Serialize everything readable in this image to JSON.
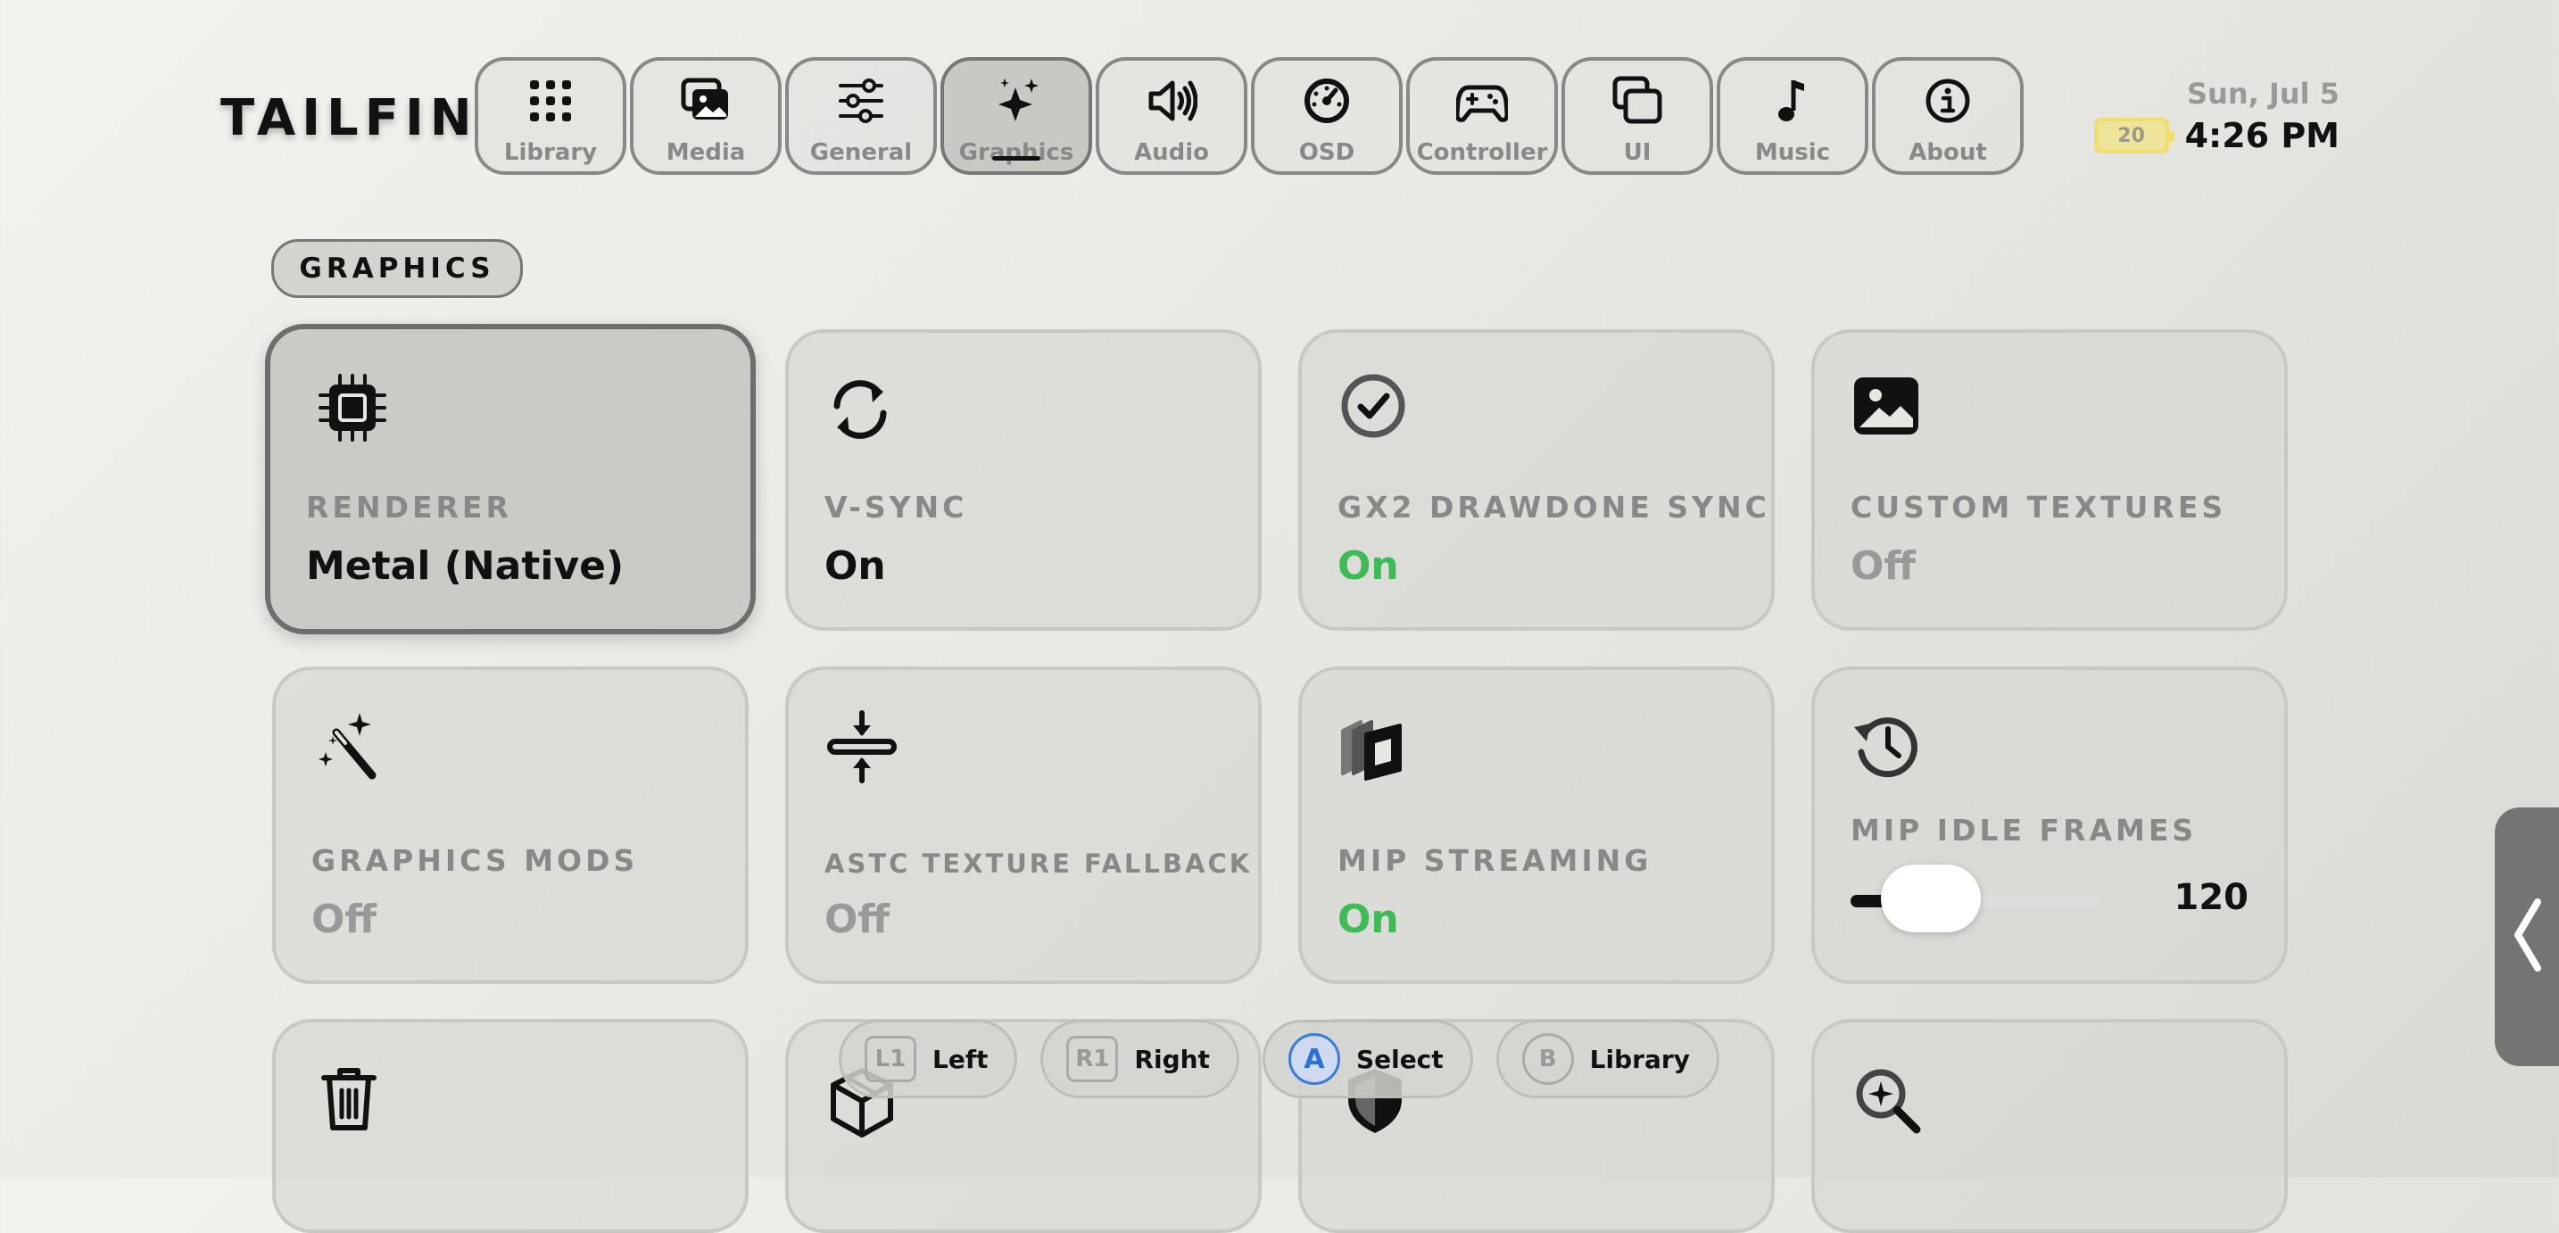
{
  "app": {
    "logo": "TAILFIN"
  },
  "tabs": [
    {
      "label": "Library",
      "icon": "grid-icon",
      "active": false
    },
    {
      "label": "Media",
      "icon": "photos-icon",
      "active": false
    },
    {
      "label": "General",
      "icon": "sliders-icon",
      "active": false
    },
    {
      "label": "Graphics",
      "icon": "sparkles-icon",
      "active": true
    },
    {
      "label": "Audio",
      "icon": "speaker-icon",
      "active": false
    },
    {
      "label": "OSD",
      "icon": "gauge-icon",
      "active": false
    },
    {
      "label": "Controller",
      "icon": "gamepad-icon",
      "active": false
    },
    {
      "label": "UI",
      "icon": "windows-icon",
      "active": false
    },
    {
      "label": "Music",
      "icon": "music-note-icon",
      "active": false
    },
    {
      "label": "About",
      "icon": "info-icon",
      "active": false
    }
  ],
  "status": {
    "date": "Sun, Jul 5",
    "time": "4:26 PM",
    "battery": "20",
    "battery_color": "#f2dd6a"
  },
  "section": {
    "title": "GRAPHICS"
  },
  "cards": [
    {
      "title": "RENDERER",
      "value": "Metal (Native)",
      "icon": "chip-icon",
      "value_color": "black",
      "selected": true
    },
    {
      "title": "V-SYNC",
      "value": "On",
      "icon": "refresh-icon",
      "value_color": "black"
    },
    {
      "title": "GX2 DRAWDONE SYNC",
      "value": "On",
      "icon": "checkmark-circle-icon",
      "value_color": "green"
    },
    {
      "title": "CUSTOM TEXTURES",
      "value": "Off",
      "icon": "photo-icon",
      "value_color": "gray"
    },
    {
      "title": "GRAPHICS MODS",
      "value": "Off",
      "icon": "magic-wand-icon",
      "value_color": "gray"
    },
    {
      "title": "ASTC TEXTURE FALLBACK",
      "value": "Off",
      "icon": "compress-icon",
      "value_color": "gray"
    },
    {
      "title": "MIP STREAMING",
      "value": "On",
      "icon": "layers-icon",
      "value_color": "green"
    },
    {
      "title": "MIP IDLE FRAMES",
      "value": "120",
      "icon": "history-icon",
      "slider_fraction": 0.12
    }
  ],
  "partial_cards": [
    {
      "icon": "trash-icon"
    },
    {
      "icon": "package-icon"
    },
    {
      "icon": "shield-icon"
    },
    {
      "icon": "magnifier-sparkle-icon"
    }
  ],
  "hints": [
    {
      "button": "L1",
      "label": "Left"
    },
    {
      "button": "R1",
      "label": "Right"
    },
    {
      "button": "A",
      "label": "Select"
    },
    {
      "button": "B",
      "label": "Library"
    }
  ],
  "colors": {
    "accent_green": "#3dbb55",
    "accent_blue": "#2c6fd8"
  }
}
